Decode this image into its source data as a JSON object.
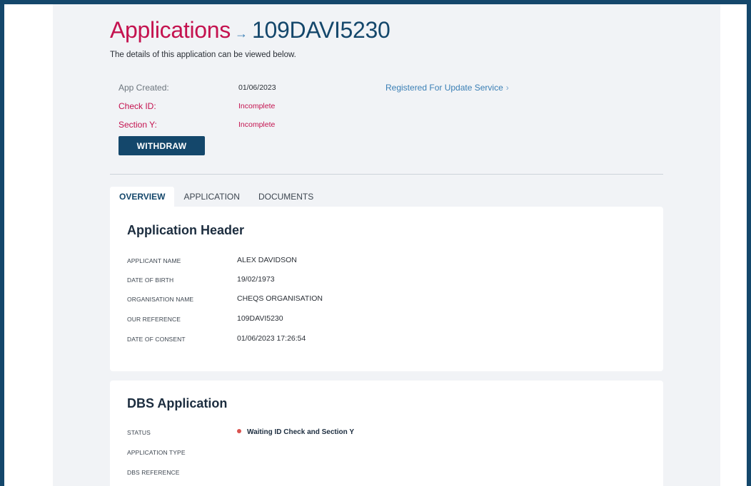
{
  "header": {
    "title": "Applications",
    "arrow": "→",
    "reference": "109DAVI5230",
    "subtitle": "The details of this application can be viewed below."
  },
  "meta": {
    "app_created_label": "App Created:",
    "app_created_value": "01/06/2023",
    "check_id_label": "Check ID:",
    "check_id_value": "Incomplete",
    "section_y_label": "Section Y:",
    "section_y_value": "Incomplete",
    "update_service_link": "Registered For Update Service",
    "update_service_chevron": "›"
  },
  "actions": {
    "withdraw_label": "WITHDRAW"
  },
  "tabs": [
    {
      "label": "OVERVIEW",
      "active": true
    },
    {
      "label": "APPLICATION",
      "active": false
    },
    {
      "label": "DOCUMENTS",
      "active": false
    }
  ],
  "application_header": {
    "title": "Application Header",
    "fields": [
      {
        "label": "APPLICANT NAME",
        "value": "ALEX DAVIDSON"
      },
      {
        "label": "DATE OF BIRTH",
        "value": "19/02/1973"
      },
      {
        "label": "ORGANISATION NAME",
        "value": "CHEQS ORGANISATION"
      },
      {
        "label": "OUR REFERENCE",
        "value": "109DAVI5230"
      },
      {
        "label": "DATE OF CONSENT",
        "value": "01/06/2023 17:26:54"
      }
    ]
  },
  "dbs_application": {
    "title": "DBS Application",
    "fields": [
      {
        "label": "STATUS",
        "value": "Waiting ID Check and Section Y"
      },
      {
        "label": "APPLICATION TYPE",
        "value": ""
      },
      {
        "label": "DBS REFERENCE",
        "value": ""
      }
    ]
  },
  "colors": {
    "brand_navy": "#14476b",
    "accent_crimson": "#c4124f",
    "link_blue": "#3a7fb5",
    "status_red": "#d9534f"
  }
}
